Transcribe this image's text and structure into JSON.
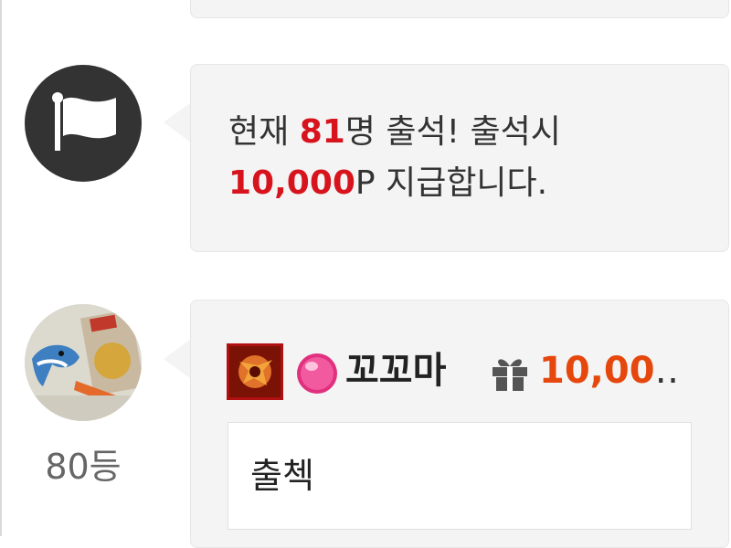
{
  "notice": {
    "icon": "flag-icon",
    "text_prefix": "현재 ",
    "count": "81",
    "text_mid": "명 출석! 출석시",
    "points": "10,000",
    "text_suffix": "P 지급합니다."
  },
  "comment": {
    "rank": "80등",
    "nickname": "꼬꼬마",
    "points": "10,00",
    "ellipsis": "…",
    "text": "출첵",
    "icons": [
      "level-badge-icon",
      "candy-icon",
      "gift-icon"
    ]
  },
  "colors": {
    "highlight_red": "#d7141e",
    "points_orange": "#e5470c",
    "bubble_bg": "#f4f4f4"
  }
}
